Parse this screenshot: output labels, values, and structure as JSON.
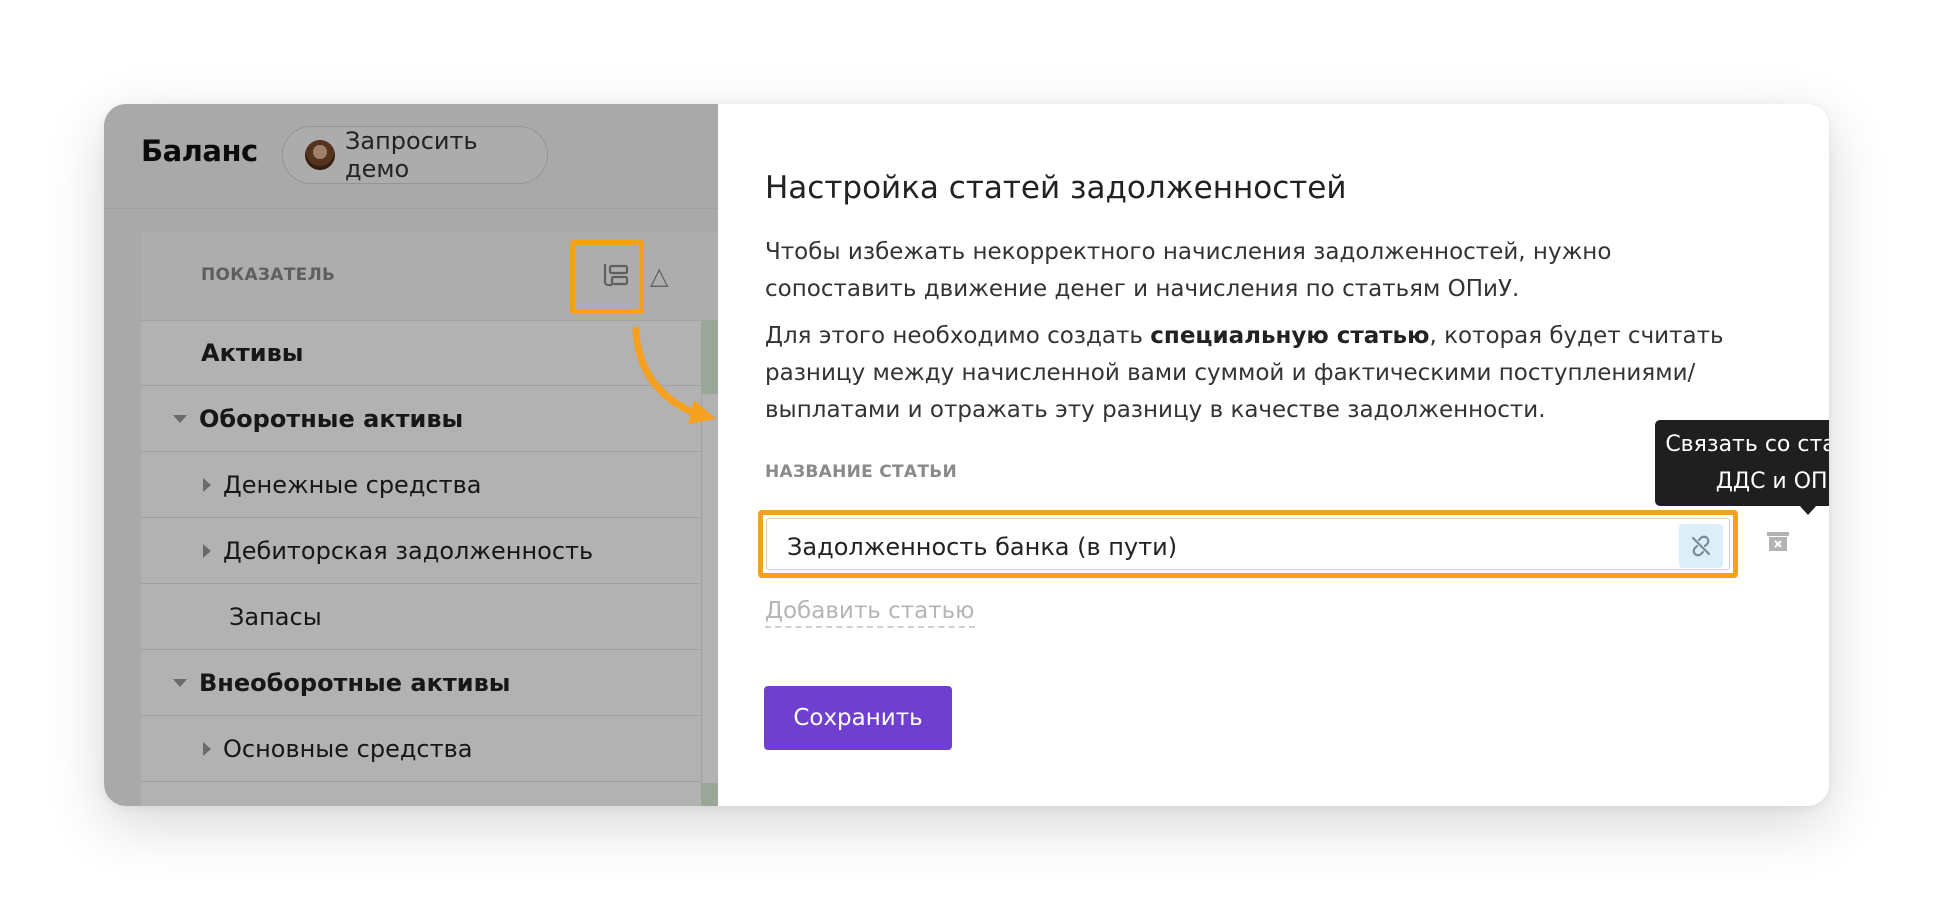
{
  "left_panel": {
    "title": "Баланс",
    "demo_button": "Запросить демо",
    "table": {
      "header_label": "ПОКАЗАТЕЛЬ",
      "sort_glyph": "△",
      "rows": [
        {
          "label": "Активы",
          "style": "bold",
          "indent": 0,
          "toggle": "none"
        },
        {
          "label": "Оборотные активы",
          "style": "bold",
          "indent": 0,
          "toggle": "expanded"
        },
        {
          "label": "Денежные средства",
          "style": "normal",
          "indent": 1,
          "toggle": "collapsed"
        },
        {
          "label": "Дебиторская задолженность",
          "style": "normal",
          "indent": 1,
          "toggle": "collapsed"
        },
        {
          "label": "Запасы",
          "style": "normal",
          "indent": 1,
          "toggle": "none"
        },
        {
          "label": "Внеоборотные активы",
          "style": "bold",
          "indent": 0,
          "toggle": "expanded"
        },
        {
          "label": "Основные средства",
          "style": "normal",
          "indent": 1,
          "toggle": "collapsed"
        }
      ]
    }
  },
  "modal": {
    "title": "Настройка статей задолженностей",
    "paragraph1": "Чтобы избежать некорректного начисления задолженностей, нужно сопоставить движение денег и начисления по статьям ОПиУ.",
    "paragraph2_before": "Для этого необходимо создать ",
    "paragraph2_bold": "специальную статью",
    "paragraph2_after": ", которая будет считать разницу между начисленной вами суммой и фактическими поступлениями/выплатами и отражать эту разницу в качестве задолженности.",
    "field_label": "НАЗВАНИЕ СТАТЬИ",
    "field_value": "Задолженность банка (в пути)",
    "tooltip_line1": "Связать со статьями",
    "tooltip_line2": "ДДС и ОПиУ",
    "add_link": "Добавить статью",
    "save_button": "Сохранить"
  },
  "colors": {
    "accent_purple": "#6f3fd0",
    "highlight_orange": "#f5a01e",
    "link_button_bg": "#dceef8"
  },
  "icons": [
    "avatar",
    "hierarchy-icon",
    "sort-triangle-icon",
    "unlink-icon",
    "trash-icon",
    "curved-arrow"
  ]
}
